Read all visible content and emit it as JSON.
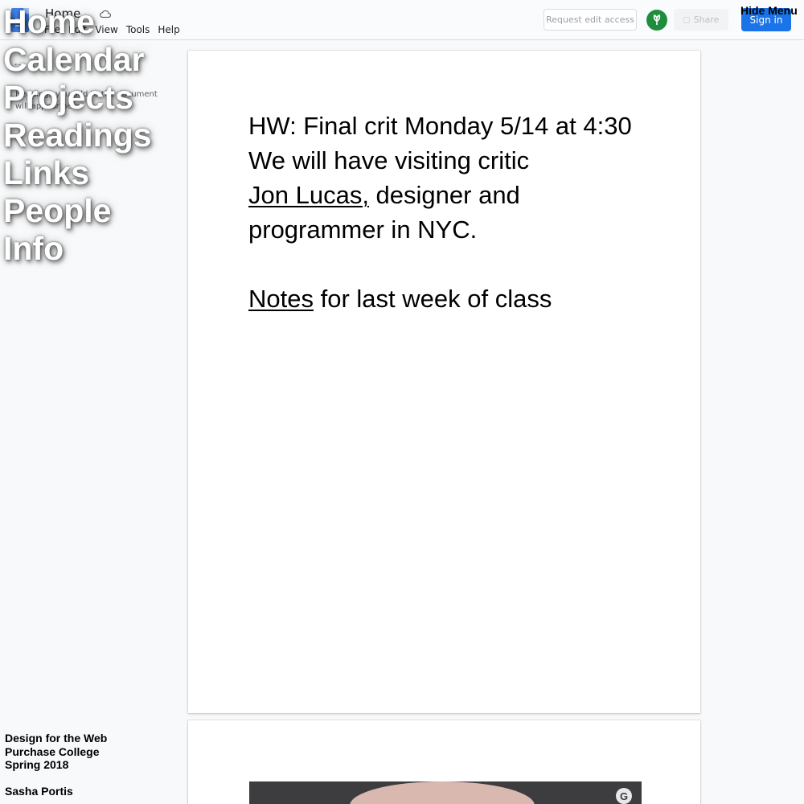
{
  "docs_toolbar": {
    "doc_title": "Home",
    "menu": [
      "File",
      "Edit",
      "View",
      "Tools",
      "Help"
    ],
    "request_edit_label": "Request edit access",
    "share_label": "Share",
    "sign_in_label": "Sign in"
  },
  "outline": {
    "hint": "Headings you add to the document will appear here."
  },
  "site_nav": {
    "hide_menu_label": "Hide Menu",
    "items": [
      "Home",
      "Calendar",
      "Projects",
      "Readings",
      "Links",
      "People",
      "Info"
    ]
  },
  "credit": {
    "course": "Design for the Web",
    "school": "Purchase College",
    "term": "Spring 2018",
    "author": "Sasha Portis"
  },
  "document": {
    "homework_line": " HW: Final crit Monday 5/14 at 4:30",
    "critic_intro": "We will have visiting critic",
    "critic_link": "Jon Lucas,",
    "critic_desc_1": " designer and",
    "critic_desc_2": "programmer in NYC.",
    "notes_link": "Notes",
    "notes_rest": " for last week of class"
  },
  "colors": {
    "sign_in_blue": "#1a73e8",
    "avatar_green": "#1e8e3e",
    "page_bg": "#f8f9fa"
  }
}
